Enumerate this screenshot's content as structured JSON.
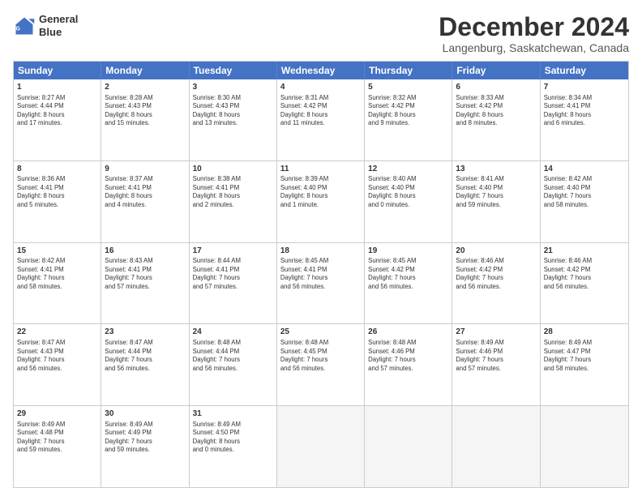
{
  "logo": {
    "line1": "General",
    "line2": "Blue"
  },
  "title": "December 2024",
  "subtitle": "Langenburg, Saskatchewan, Canada",
  "headers": [
    "Sunday",
    "Monday",
    "Tuesday",
    "Wednesday",
    "Thursday",
    "Friday",
    "Saturday"
  ],
  "weeks": [
    [
      {
        "day": "1",
        "lines": [
          "Sunrise: 8:27 AM",
          "Sunset: 4:44 PM",
          "Daylight: 8 hours",
          "and 17 minutes."
        ]
      },
      {
        "day": "2",
        "lines": [
          "Sunrise: 8:28 AM",
          "Sunset: 4:43 PM",
          "Daylight: 8 hours",
          "and 15 minutes."
        ]
      },
      {
        "day": "3",
        "lines": [
          "Sunrise: 8:30 AM",
          "Sunset: 4:43 PM",
          "Daylight: 8 hours",
          "and 13 minutes."
        ]
      },
      {
        "day": "4",
        "lines": [
          "Sunrise: 8:31 AM",
          "Sunset: 4:42 PM",
          "Daylight: 8 hours",
          "and 11 minutes."
        ]
      },
      {
        "day": "5",
        "lines": [
          "Sunrise: 8:32 AM",
          "Sunset: 4:42 PM",
          "Daylight: 8 hours",
          "and 9 minutes."
        ]
      },
      {
        "day": "6",
        "lines": [
          "Sunrise: 8:33 AM",
          "Sunset: 4:42 PM",
          "Daylight: 8 hours",
          "and 8 minutes."
        ]
      },
      {
        "day": "7",
        "lines": [
          "Sunrise: 8:34 AM",
          "Sunset: 4:41 PM",
          "Daylight: 8 hours",
          "and 6 minutes."
        ]
      }
    ],
    [
      {
        "day": "8",
        "lines": [
          "Sunrise: 8:36 AM",
          "Sunset: 4:41 PM",
          "Daylight: 8 hours",
          "and 5 minutes."
        ]
      },
      {
        "day": "9",
        "lines": [
          "Sunrise: 8:37 AM",
          "Sunset: 4:41 PM",
          "Daylight: 8 hours",
          "and 4 minutes."
        ]
      },
      {
        "day": "10",
        "lines": [
          "Sunrise: 8:38 AM",
          "Sunset: 4:41 PM",
          "Daylight: 8 hours",
          "and 2 minutes."
        ]
      },
      {
        "day": "11",
        "lines": [
          "Sunrise: 8:39 AM",
          "Sunset: 4:40 PM",
          "Daylight: 8 hours",
          "and 1 minute."
        ]
      },
      {
        "day": "12",
        "lines": [
          "Sunrise: 8:40 AM",
          "Sunset: 4:40 PM",
          "Daylight: 8 hours",
          "and 0 minutes."
        ]
      },
      {
        "day": "13",
        "lines": [
          "Sunrise: 8:41 AM",
          "Sunset: 4:40 PM",
          "Daylight: 7 hours",
          "and 59 minutes."
        ]
      },
      {
        "day": "14",
        "lines": [
          "Sunrise: 8:42 AM",
          "Sunset: 4:40 PM",
          "Daylight: 7 hours",
          "and 58 minutes."
        ]
      }
    ],
    [
      {
        "day": "15",
        "lines": [
          "Sunrise: 8:42 AM",
          "Sunset: 4:41 PM",
          "Daylight: 7 hours",
          "and 58 minutes."
        ]
      },
      {
        "day": "16",
        "lines": [
          "Sunrise: 8:43 AM",
          "Sunset: 4:41 PM",
          "Daylight: 7 hours",
          "and 57 minutes."
        ]
      },
      {
        "day": "17",
        "lines": [
          "Sunrise: 8:44 AM",
          "Sunset: 4:41 PM",
          "Daylight: 7 hours",
          "and 57 minutes."
        ]
      },
      {
        "day": "18",
        "lines": [
          "Sunrise: 8:45 AM",
          "Sunset: 4:41 PM",
          "Daylight: 7 hours",
          "and 56 minutes."
        ]
      },
      {
        "day": "19",
        "lines": [
          "Sunrise: 8:45 AM",
          "Sunset: 4:42 PM",
          "Daylight: 7 hours",
          "and 56 minutes."
        ]
      },
      {
        "day": "20",
        "lines": [
          "Sunrise: 8:46 AM",
          "Sunset: 4:42 PM",
          "Daylight: 7 hours",
          "and 56 minutes."
        ]
      },
      {
        "day": "21",
        "lines": [
          "Sunrise: 8:46 AM",
          "Sunset: 4:42 PM",
          "Daylight: 7 hours",
          "and 56 minutes."
        ]
      }
    ],
    [
      {
        "day": "22",
        "lines": [
          "Sunrise: 8:47 AM",
          "Sunset: 4:43 PM",
          "Daylight: 7 hours",
          "and 56 minutes."
        ]
      },
      {
        "day": "23",
        "lines": [
          "Sunrise: 8:47 AM",
          "Sunset: 4:44 PM",
          "Daylight: 7 hours",
          "and 56 minutes."
        ]
      },
      {
        "day": "24",
        "lines": [
          "Sunrise: 8:48 AM",
          "Sunset: 4:44 PM",
          "Daylight: 7 hours",
          "and 56 minutes."
        ]
      },
      {
        "day": "25",
        "lines": [
          "Sunrise: 8:48 AM",
          "Sunset: 4:45 PM",
          "Daylight: 7 hours",
          "and 56 minutes."
        ]
      },
      {
        "day": "26",
        "lines": [
          "Sunrise: 8:48 AM",
          "Sunset: 4:46 PM",
          "Daylight: 7 hours",
          "and 57 minutes."
        ]
      },
      {
        "day": "27",
        "lines": [
          "Sunrise: 8:49 AM",
          "Sunset: 4:46 PM",
          "Daylight: 7 hours",
          "and 57 minutes."
        ]
      },
      {
        "day": "28",
        "lines": [
          "Sunrise: 8:49 AM",
          "Sunset: 4:47 PM",
          "Daylight: 7 hours",
          "and 58 minutes."
        ]
      }
    ],
    [
      {
        "day": "29",
        "lines": [
          "Sunrise: 8:49 AM",
          "Sunset: 4:48 PM",
          "Daylight: 7 hours",
          "and 59 minutes."
        ]
      },
      {
        "day": "30",
        "lines": [
          "Sunrise: 8:49 AM",
          "Sunset: 4:49 PM",
          "Daylight: 7 hours",
          "and 59 minutes."
        ]
      },
      {
        "day": "31",
        "lines": [
          "Sunrise: 8:49 AM",
          "Sunset: 4:50 PM",
          "Daylight: 8 hours",
          "and 0 minutes."
        ]
      },
      null,
      null,
      null,
      null
    ]
  ]
}
